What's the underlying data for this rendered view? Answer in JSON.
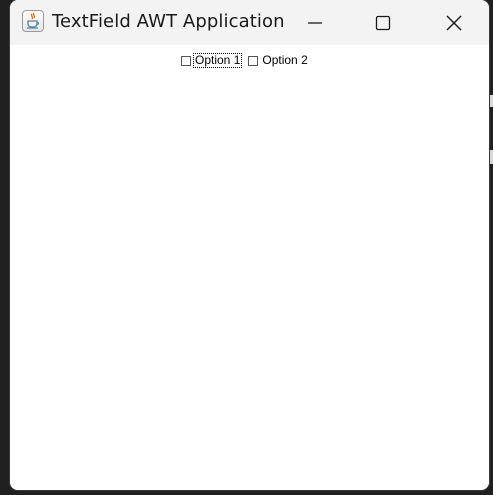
{
  "window": {
    "title": "TextField AWT Application",
    "app_icon": "java-cup-icon",
    "controls": {
      "minimize_icon": "minimize-icon",
      "maximize_icon": "maximize-icon",
      "close_icon": "close-icon"
    }
  },
  "content": {
    "checkboxes": [
      {
        "label": "Option 1",
        "checked": false,
        "focused": true
      },
      {
        "label": "Option 2",
        "checked": false,
        "focused": false
      }
    ]
  }
}
